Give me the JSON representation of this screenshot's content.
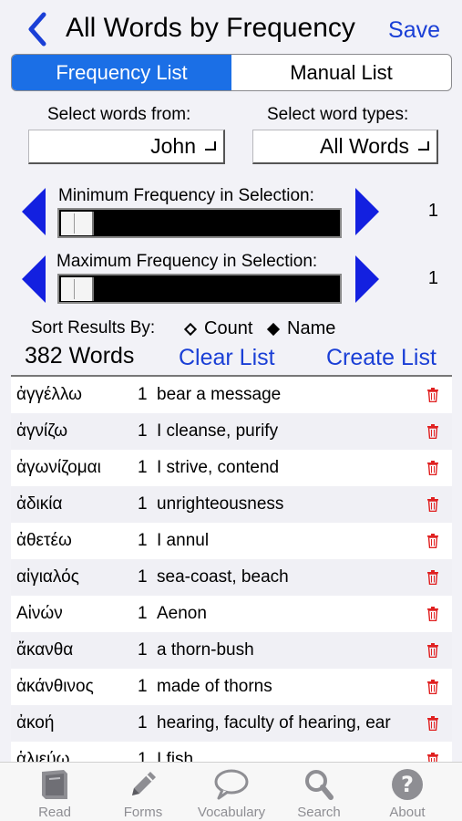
{
  "nav": {
    "title": "All Words by Frequency",
    "save_label": "Save",
    "back_icon": "chevron-left-icon"
  },
  "segment": {
    "options": [
      "Frequency List",
      "Manual List"
    ],
    "selected": 0
  },
  "select_words": {
    "label": "Select words from:",
    "value": "John"
  },
  "select_types": {
    "label": "Select word types:",
    "value": "All Words"
  },
  "min_freq": {
    "label": "Minimum Frequency in Selection:",
    "value": "1"
  },
  "max_freq": {
    "label": "Maximum Frequency in Selection:",
    "value": "1"
  },
  "sort": {
    "label": "Sort Results By:",
    "options": [
      "Count",
      "Name"
    ],
    "selected": "Name"
  },
  "results": {
    "count": "382 Words",
    "clear_label": "Clear List",
    "create_label": "Create List"
  },
  "words": [
    {
      "greek": "ἀγγέλλω",
      "freq": "1",
      "def": "bear a message"
    },
    {
      "greek": "ἁγνίζω",
      "freq": "1",
      "def": "I cleanse, purify"
    },
    {
      "greek": "ἀγωνίζομαι",
      "freq": "1",
      "def": "I strive, contend"
    },
    {
      "greek": "ἀδικία",
      "freq": "1",
      "def": "unrighteousness"
    },
    {
      "greek": "ἀθετέω",
      "freq": "1",
      "def": "I annul"
    },
    {
      "greek": "αἰγιαλός",
      "freq": "1",
      "def": "sea-coast, beach"
    },
    {
      "greek": "Αἰνών",
      "freq": "1",
      "def": "Aenon"
    },
    {
      "greek": "ἄκανθα",
      "freq": "1",
      "def": "a thorn-bush"
    },
    {
      "greek": "ἀκάνθινος",
      "freq": "1",
      "def": "made of thorns"
    },
    {
      "greek": "ἀκοή",
      "freq": "1",
      "def": "hearing, faculty of hearing, ear"
    },
    {
      "greek": "ἁλιεύω",
      "freq": "1",
      "def": "I fish"
    }
  ],
  "tabs": [
    {
      "label": "Read",
      "icon": "book-icon"
    },
    {
      "label": "Forms",
      "icon": "pencil-icon"
    },
    {
      "label": "Vocabulary",
      "icon": "speech-bubble-icon"
    },
    {
      "label": "Search",
      "icon": "magnifier-icon"
    },
    {
      "label": "About",
      "icon": "question-icon"
    }
  ],
  "colors": {
    "accent": "#1a3fd6",
    "segment_active": "#1b6fe6",
    "arrow": "#1320e0",
    "trash": "#e02020",
    "tab_icon": "#8e8e93"
  }
}
